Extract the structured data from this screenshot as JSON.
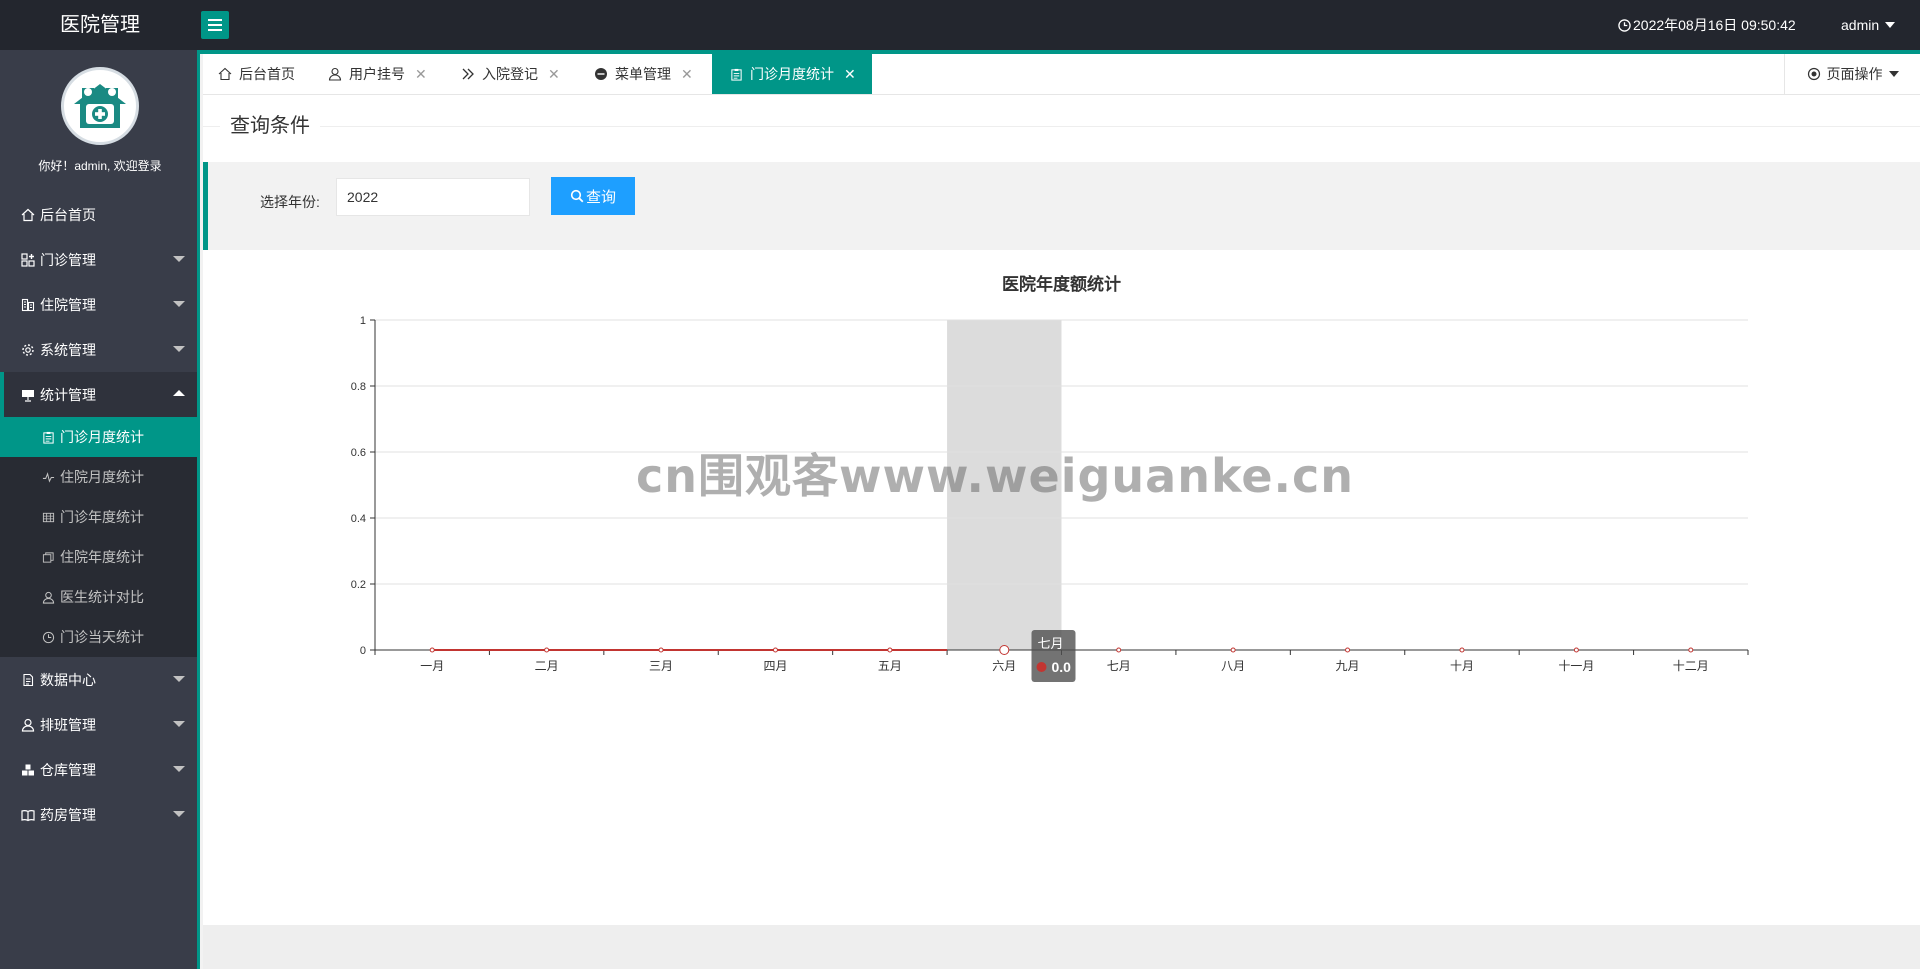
{
  "app": {
    "title": "医院管理",
    "datetime": "2022年08月16日 09:50:42",
    "user": "admin"
  },
  "sidebar": {
    "greeting": "你好！admin, 欢迎登录",
    "items": [
      {
        "label": "后台首页",
        "icon": "home-icon"
      },
      {
        "label": "门诊管理",
        "icon": "apps-icon"
      },
      {
        "label": "住院管理",
        "icon": "building-icon"
      },
      {
        "label": "系统管理",
        "icon": "gear-icon"
      },
      {
        "label": "统计管理",
        "icon": "chart-board-icon"
      },
      {
        "label": "数据中心",
        "icon": "document-icon"
      },
      {
        "label": "排班管理",
        "icon": "user-icon"
      },
      {
        "label": "仓库管理",
        "icon": "boxes-icon"
      },
      {
        "label": "药房管理",
        "icon": "book-icon"
      }
    ],
    "subitems": [
      {
        "label": "门诊月度统计",
        "icon": "clipboard-icon"
      },
      {
        "label": "住院月度统计",
        "icon": "pulse-icon"
      },
      {
        "label": "门诊年度统计",
        "icon": "table-icon"
      },
      {
        "label": "住院年度统计",
        "icon": "pages-icon"
      },
      {
        "label": "医生统计对比",
        "icon": "user-icon"
      },
      {
        "label": "门诊当天统计",
        "icon": "clock-icon"
      }
    ]
  },
  "tabs": [
    {
      "label": "后台首页",
      "icon": "home-icon"
    },
    {
      "label": "用户挂号",
      "icon": "user-icon"
    },
    {
      "label": "入院登记",
      "icon": "double-chevron-icon"
    },
    {
      "label": "菜单管理",
      "icon": "circle-icon"
    },
    {
      "label": "门诊月度统计",
      "icon": "clipboard-icon"
    }
  ],
  "page_ops": "页面操作",
  "query": {
    "legend": "查询条件",
    "label": "选择年份:",
    "year_value": "2022",
    "button": "查询"
  },
  "chart_data": {
    "type": "line",
    "title": "医院年度额统计",
    "categories": [
      "一月",
      "二月",
      "三月",
      "四月",
      "五月",
      "六月",
      "七月",
      "八月",
      "九月",
      "十月",
      "十一月",
      "十二月"
    ],
    "series": [
      {
        "values": [
          0,
          0,
          0,
          0,
          0,
          0,
          0,
          0,
          0,
          0,
          0,
          0
        ],
        "color": "#c23531"
      }
    ],
    "yticks": [
      "0",
      "0.2",
      "0.4",
      "0.6",
      "0.8",
      "1"
    ],
    "ylim": [
      0,
      1
    ],
    "grid": true,
    "highlighted_category": "六月",
    "tooltip": {
      "title": "七月",
      "value": "0.0"
    }
  },
  "watermark": "cn围观客www.weiguanke.cn"
}
